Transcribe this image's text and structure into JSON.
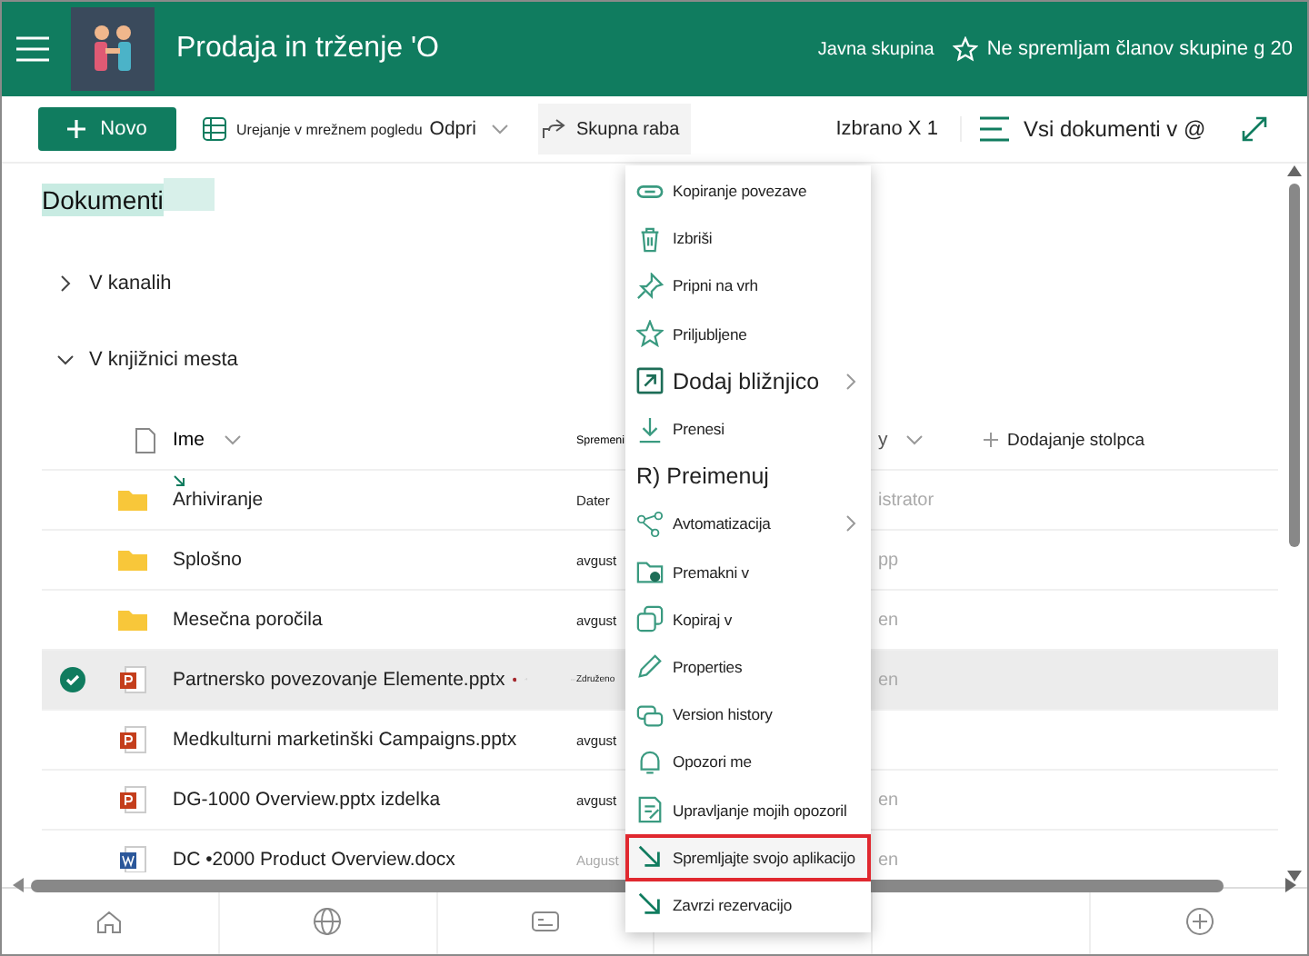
{
  "header": {
    "title": "Prodaja in trženje 'O",
    "privacy": "Javna skupina",
    "follow": "Ne spremljam članov skupine g 20"
  },
  "toolbar": {
    "new_button": "Novo",
    "grid_edit": "Urejanje v mrežnem pogledu",
    "open": "Odpri",
    "share": "Skupna raba",
    "selection": "Izbrano X 1",
    "view": "Vsi dokumenti v @"
  },
  "library": {
    "title": "Dokumenti",
    "groups": [
      {
        "label": "V kanalih",
        "expanded": false
      },
      {
        "label": "V knjižnici mesta",
        "expanded": true
      }
    ]
  },
  "table": {
    "columns": [
      "Ime",
      "Spremeni",
      "y",
      "Dodajanje stolpca"
    ],
    "rows": [
      {
        "kind": "folder",
        "name": "Arhiviranje",
        "modified": "Dater",
        "modified_by": "istrator",
        "selected": false,
        "new": true
      },
      {
        "kind": "folder",
        "name": "Splošno",
        "modified": "avgust",
        "modified_by": "pp",
        "selected": false,
        "new": false
      },
      {
        "kind": "folder",
        "name": "Mesečna poročila",
        "modified": "avgust",
        "modified_by": "en",
        "selected": false,
        "new": false
      },
      {
        "kind": "pptx",
        "name": "Partnersko povezovanje Elemente.pptx",
        "modified": "Združeno",
        "modified_by": "en",
        "selected": true,
        "new": false
      },
      {
        "kind": "pptx",
        "name": "Medkulturni marketinški Campaigns.pptx",
        "modified": "avgust",
        "selected": false,
        "new": false
      },
      {
        "kind": "pptx",
        "name": "DG-1000 Overview.pptx izdelka",
        "modified": "avgust",
        "modified_by": "en",
        "selected": false,
        "new": false
      },
      {
        "kind": "docx",
        "name": "DC •2000 Product Overview.docx",
        "modified": "August",
        "modified_by": "en",
        "selected": false,
        "new": false
      }
    ]
  },
  "context_menu": [
    {
      "label": "Kopiranje povezave",
      "large": false,
      "submenu": false,
      "highlighted": false
    },
    {
      "label": "Izbriši",
      "large": false,
      "submenu": false,
      "highlighted": false
    },
    {
      "label": "Pripni na vrh",
      "large": false,
      "submenu": false,
      "highlighted": false
    },
    {
      "label": "Priljubljene",
      "large": false,
      "submenu": false,
      "highlighted": false
    },
    {
      "label": "Dodaj bližnjico",
      "large": true,
      "submenu": true,
      "highlighted": false
    },
    {
      "label": "Prenesi",
      "large": false,
      "submenu": false,
      "highlighted": false
    },
    {
      "label": "R) Preimenuj",
      "large": true,
      "submenu": false,
      "highlighted": false
    },
    {
      "label": "Avtomatizacija",
      "large": false,
      "submenu": true,
      "highlighted": false
    },
    {
      "label": "Premakni v",
      "large": false,
      "submenu": false,
      "highlighted": false
    },
    {
      "label": "Kopiraj v",
      "large": false,
      "submenu": false,
      "highlighted": false
    },
    {
      "label": "Properties",
      "large": false,
      "submenu": false,
      "highlighted": false
    },
    {
      "label": "Version history",
      "large": false,
      "submenu": false,
      "highlighted": false
    },
    {
      "label": "Opozori me",
      "large": false,
      "submenu": false,
      "highlighted": false
    },
    {
      "label": "Upravljanje mojih opozoril",
      "large": false,
      "submenu": false,
      "highlighted": false
    },
    {
      "label": "Spremljajte svojo aplikacijo",
      "large": false,
      "submenu": false,
      "highlighted": true
    },
    {
      "label": "Zavrzi rezervacijo",
      "large": false,
      "submenu": false,
      "highlighted": false
    }
  ]
}
